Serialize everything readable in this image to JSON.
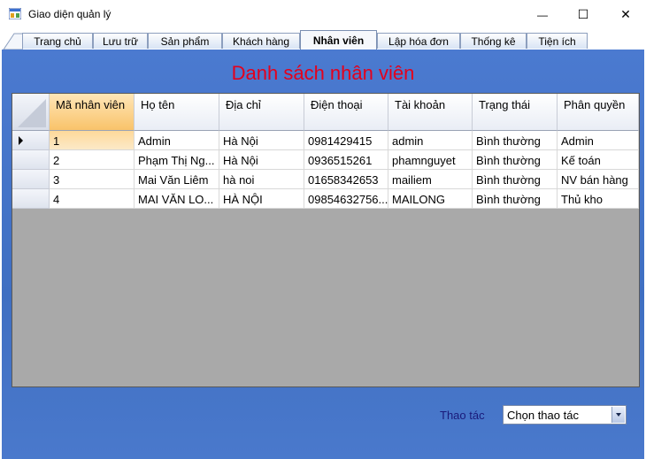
{
  "window": {
    "title": "Giao diện quản lý",
    "minimize": "—",
    "maximize": "☐",
    "close": "✕"
  },
  "tabs": [
    {
      "label": "Trang chủ",
      "active": false
    },
    {
      "label": "Lưu trữ",
      "active": false
    },
    {
      "label": "Sản phẩm",
      "active": false
    },
    {
      "label": "Khách hàng",
      "active": false
    },
    {
      "label": "Nhân viên",
      "active": true
    },
    {
      "label": "Lập hóa đơn",
      "active": false
    },
    {
      "label": "Thống kê",
      "active": false
    },
    {
      "label": "Tiện ích",
      "active": false
    }
  ],
  "heading": "Danh sách nhân viên",
  "table": {
    "columns": [
      "Mã nhân viên",
      "Họ tên",
      "Địa chỉ",
      "Điện thoại",
      "Tài khoản",
      "Trạng thái",
      "Phân quyền"
    ],
    "rows": [
      [
        "1",
        "Admin",
        "Hà Nội",
        "0981429415",
        "admin",
        "Bình thường",
        "Admin"
      ],
      [
        "2",
        "Phạm Thị Ng...",
        "Hà Nội",
        "0936515261",
        "phamnguyet",
        "Bình thường",
        "Kế toán"
      ],
      [
        "3",
        "Mai Văn Liêm",
        "hà noi",
        "01658342653",
        "mailiem",
        "Bình thường",
        "NV bán hàng"
      ],
      [
        "4",
        "MAI VĂN LO...",
        "HÀ NỘI",
        "09854632756...",
        "MAILONG",
        "Bình thường",
        "Thủ kho"
      ]
    ],
    "selected_row": 0
  },
  "operation": {
    "label": "Thao tác",
    "value": "Chọn thao tác"
  },
  "colors": {
    "panel_blue": "#4a78c8",
    "heading_red": "#e4001c",
    "grid_background": "#a9a9a9",
    "selected_header": "#f9c36a"
  }
}
